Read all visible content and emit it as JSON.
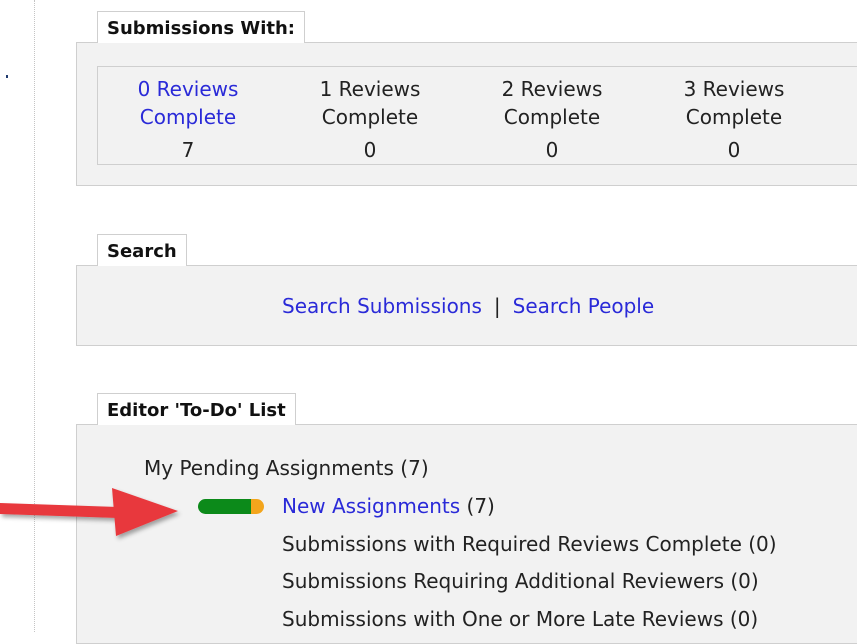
{
  "colors": {
    "link": "#2a2ad8",
    "panel_bg": "#f2f2f2",
    "border": "#cfcfcf",
    "arrow": "#e8383d",
    "status_bar_green": "#0c8a1a",
    "status_bar_orange": "#f3a51c"
  },
  "submissions_with": {
    "title": "Submissions With:",
    "items": [
      {
        "label": "0 Reviews Complete",
        "count": "7"
      },
      {
        "label": "1 Reviews Complete",
        "count": "0"
      },
      {
        "label": "2 Reviews Complete",
        "count": "0"
      },
      {
        "label": "3 Reviews Complete",
        "count": "0"
      }
    ]
  },
  "search": {
    "title": "Search",
    "submissions_link": "Search Submissions",
    "separator": "|",
    "people_link": "Search People"
  },
  "todo": {
    "title": "Editor 'To-Do' List",
    "pending": "My Pending Assignments (7)",
    "new_assignments_link": "New Assignments",
    "new_assignments_count": "(7)",
    "items": [
      "Submissions with Required Reviews Complete (0)",
      "Submissions Requiring Additional Reviewers (0)",
      "Submissions with One or More Late Reviews (0)"
    ]
  },
  "icons": {
    "annotation_arrow": "arrow-right-icon",
    "status_bar": "progress-bar-icon"
  }
}
